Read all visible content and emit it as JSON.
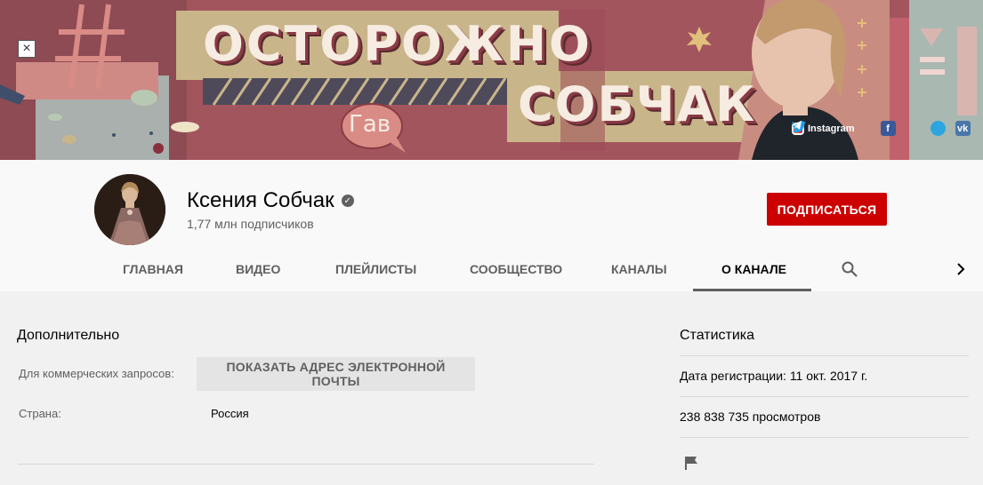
{
  "banner": {
    "title_line1": "ОСТОРОЖНО",
    "title_line2": "СОБЧАК",
    "speech": "Гав",
    "close_symbol": "×",
    "links": {
      "instagram": "Instagram",
      "facebook_icon": "facebook-icon",
      "twitter_icon": "twitter-icon",
      "telegram_icon": "telegram-icon",
      "vk_icon": "vk-icon"
    },
    "colors": {
      "background": "#a3555e",
      "panel": "#c9b58a",
      "cream": "#f6ece2"
    }
  },
  "channel": {
    "name": "Ксения Собчак",
    "verified_icon": "check-circle-icon",
    "subscribers": "1,77 млн подписчиков",
    "subscribe_label": "ПОДПИСАТЬСЯ"
  },
  "tabs": {
    "home": "ГЛАВНАЯ",
    "videos": "ВИДЕО",
    "playlists": "ПЛЕЙЛИСТЫ",
    "community": "СООБЩЕСТВО",
    "channels": "КАНАЛЫ",
    "about": "О КАНАЛЕ",
    "active": "О КАНАЛЕ",
    "search_icon": "search-icon",
    "next_icon": "chevron-right-icon"
  },
  "details": {
    "title": "Дополнительно",
    "business_label": "Для коммерческих запросов:",
    "email_button": "ПОКАЗАТЬ АДРЕС ЭЛЕКТРОННОЙ ПОЧТЫ",
    "country_label": "Страна:",
    "country_value": "Россия"
  },
  "stats": {
    "title": "Статистика",
    "joined": "Дата регистрации: 11 окт. 2017 г.",
    "views": "238 838 735 просмотров",
    "flag_icon": "flag-icon"
  },
  "accent_colors": {
    "subscribe": "#cc0000",
    "text_secondary": "#606060"
  }
}
